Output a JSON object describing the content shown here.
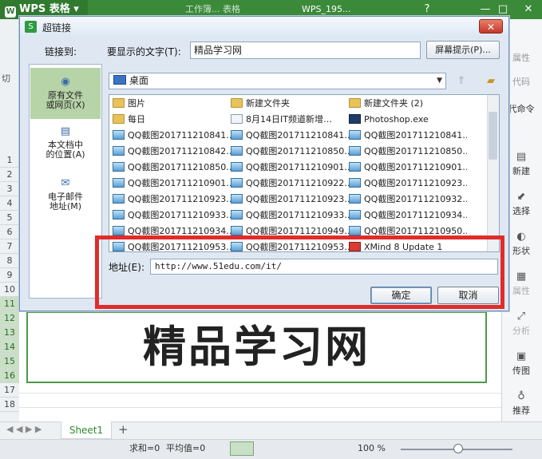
{
  "wps": {
    "app_name": "WPS 表格",
    "tabs": [
      "工作簿... 表格",
      "WPS_195..."
    ],
    "controls": {
      "question": "?",
      "minimize": "—",
      "maximize": "□",
      "close": "✕"
    },
    "left_partial": "切",
    "rows": [
      "1",
      "2",
      "3",
      "4",
      "5",
      "6",
      "7",
      "8",
      "9",
      "10",
      "11",
      "12",
      "13",
      "14",
      "15",
      "16",
      "17",
      "18"
    ],
    "selected_rows": [
      "11",
      "12",
      "13",
      "14",
      "15",
      "16"
    ],
    "merged_cell_text": "精品学习网",
    "sheet_tab": "Sheet1",
    "status": {
      "sum": "求和=0",
      "avg": "平均值=0",
      "zoom": "100 %"
    },
    "right_panel": {
      "partial_top": [
        "属性",
        "代码",
        "代命令"
      ],
      "items": [
        {
          "label": "新建",
          "icon": "new-icon",
          "enabled": true
        },
        {
          "label": "选择",
          "icon": "select-icon",
          "enabled": true
        },
        {
          "label": "形状",
          "icon": "shape-icon",
          "enabled": true
        },
        {
          "label": "属性",
          "icon": "properties-icon",
          "enabled": false
        },
        {
          "label": "分析",
          "icon": "analyze-icon",
          "enabled": false
        },
        {
          "label": "传图",
          "icon": "upload-image-icon",
          "enabled": true
        },
        {
          "label": "推荐",
          "icon": "recommend-icon",
          "enabled": true
        }
      ]
    }
  },
  "dialog": {
    "title": "超链接",
    "link_to_label": "链接到:",
    "display_text_label": "要显示的文字(T):",
    "display_text_value": "精品学习网",
    "screen_tip_button": "屏幕提示(P)...",
    "link_types": [
      {
        "label_line1": "原有文件",
        "label_line2": "或网页(X)",
        "icon": "web-file-icon",
        "active": true
      },
      {
        "label_line1": "本文档中",
        "label_line2": "的位置(A)",
        "icon": "document-place-icon",
        "active": false
      },
      {
        "label_line1": "电子邮件",
        "label_line2": "地址(M)",
        "icon": "email-icon",
        "active": false
      }
    ],
    "location": "桌面",
    "files": [
      [
        "图片",
        "新建文件夹",
        "新建文件夹 (2)"
      ],
      [
        "每日",
        "8月14日IT频道新增…",
        "Photoshop.exe"
      ],
      [
        "QQ截图201711210841…",
        "QQ截图201711210841…",
        "QQ截图201711210841…"
      ],
      [
        "QQ截图201711210842…",
        "QQ截图201711210850…",
        "QQ截图201711210850…"
      ],
      [
        "QQ截图201711210850…",
        "QQ截图201711210901…",
        "QQ截图201711210901…"
      ],
      [
        "QQ截图201711210901…",
        "QQ截图201711210922…",
        "QQ截图201711210923…"
      ],
      [
        "QQ截图201711210923…",
        "QQ截图201711210923…",
        "QQ截图201711210932…"
      ],
      [
        "QQ截图201711210933…",
        "QQ截图201711210933…",
        "QQ截图201711210934…"
      ],
      [
        "QQ截图201711210934…",
        "QQ截图201711210949…",
        "QQ截图201711210950…"
      ],
      [
        "QQ截图201711210953…",
        "QQ截图201711210953…",
        "XMind 8 Update 1"
      ]
    ],
    "file_icons": [
      [
        "folder",
        "folder",
        "folder"
      ],
      [
        "folder",
        "wdoc",
        "ps"
      ],
      [
        "img",
        "img",
        "img"
      ],
      [
        "img",
        "img",
        "img"
      ],
      [
        "img",
        "img",
        "img"
      ],
      [
        "img",
        "img",
        "img"
      ],
      [
        "img",
        "img",
        "img"
      ],
      [
        "img",
        "img",
        "img"
      ],
      [
        "img",
        "img",
        "img"
      ],
      [
        "img",
        "img",
        "xm"
      ]
    ],
    "address_label": "地址(E):",
    "address_value": "http://www.51edu.com/it/",
    "ok_button": "确定",
    "cancel_button": "取消"
  }
}
